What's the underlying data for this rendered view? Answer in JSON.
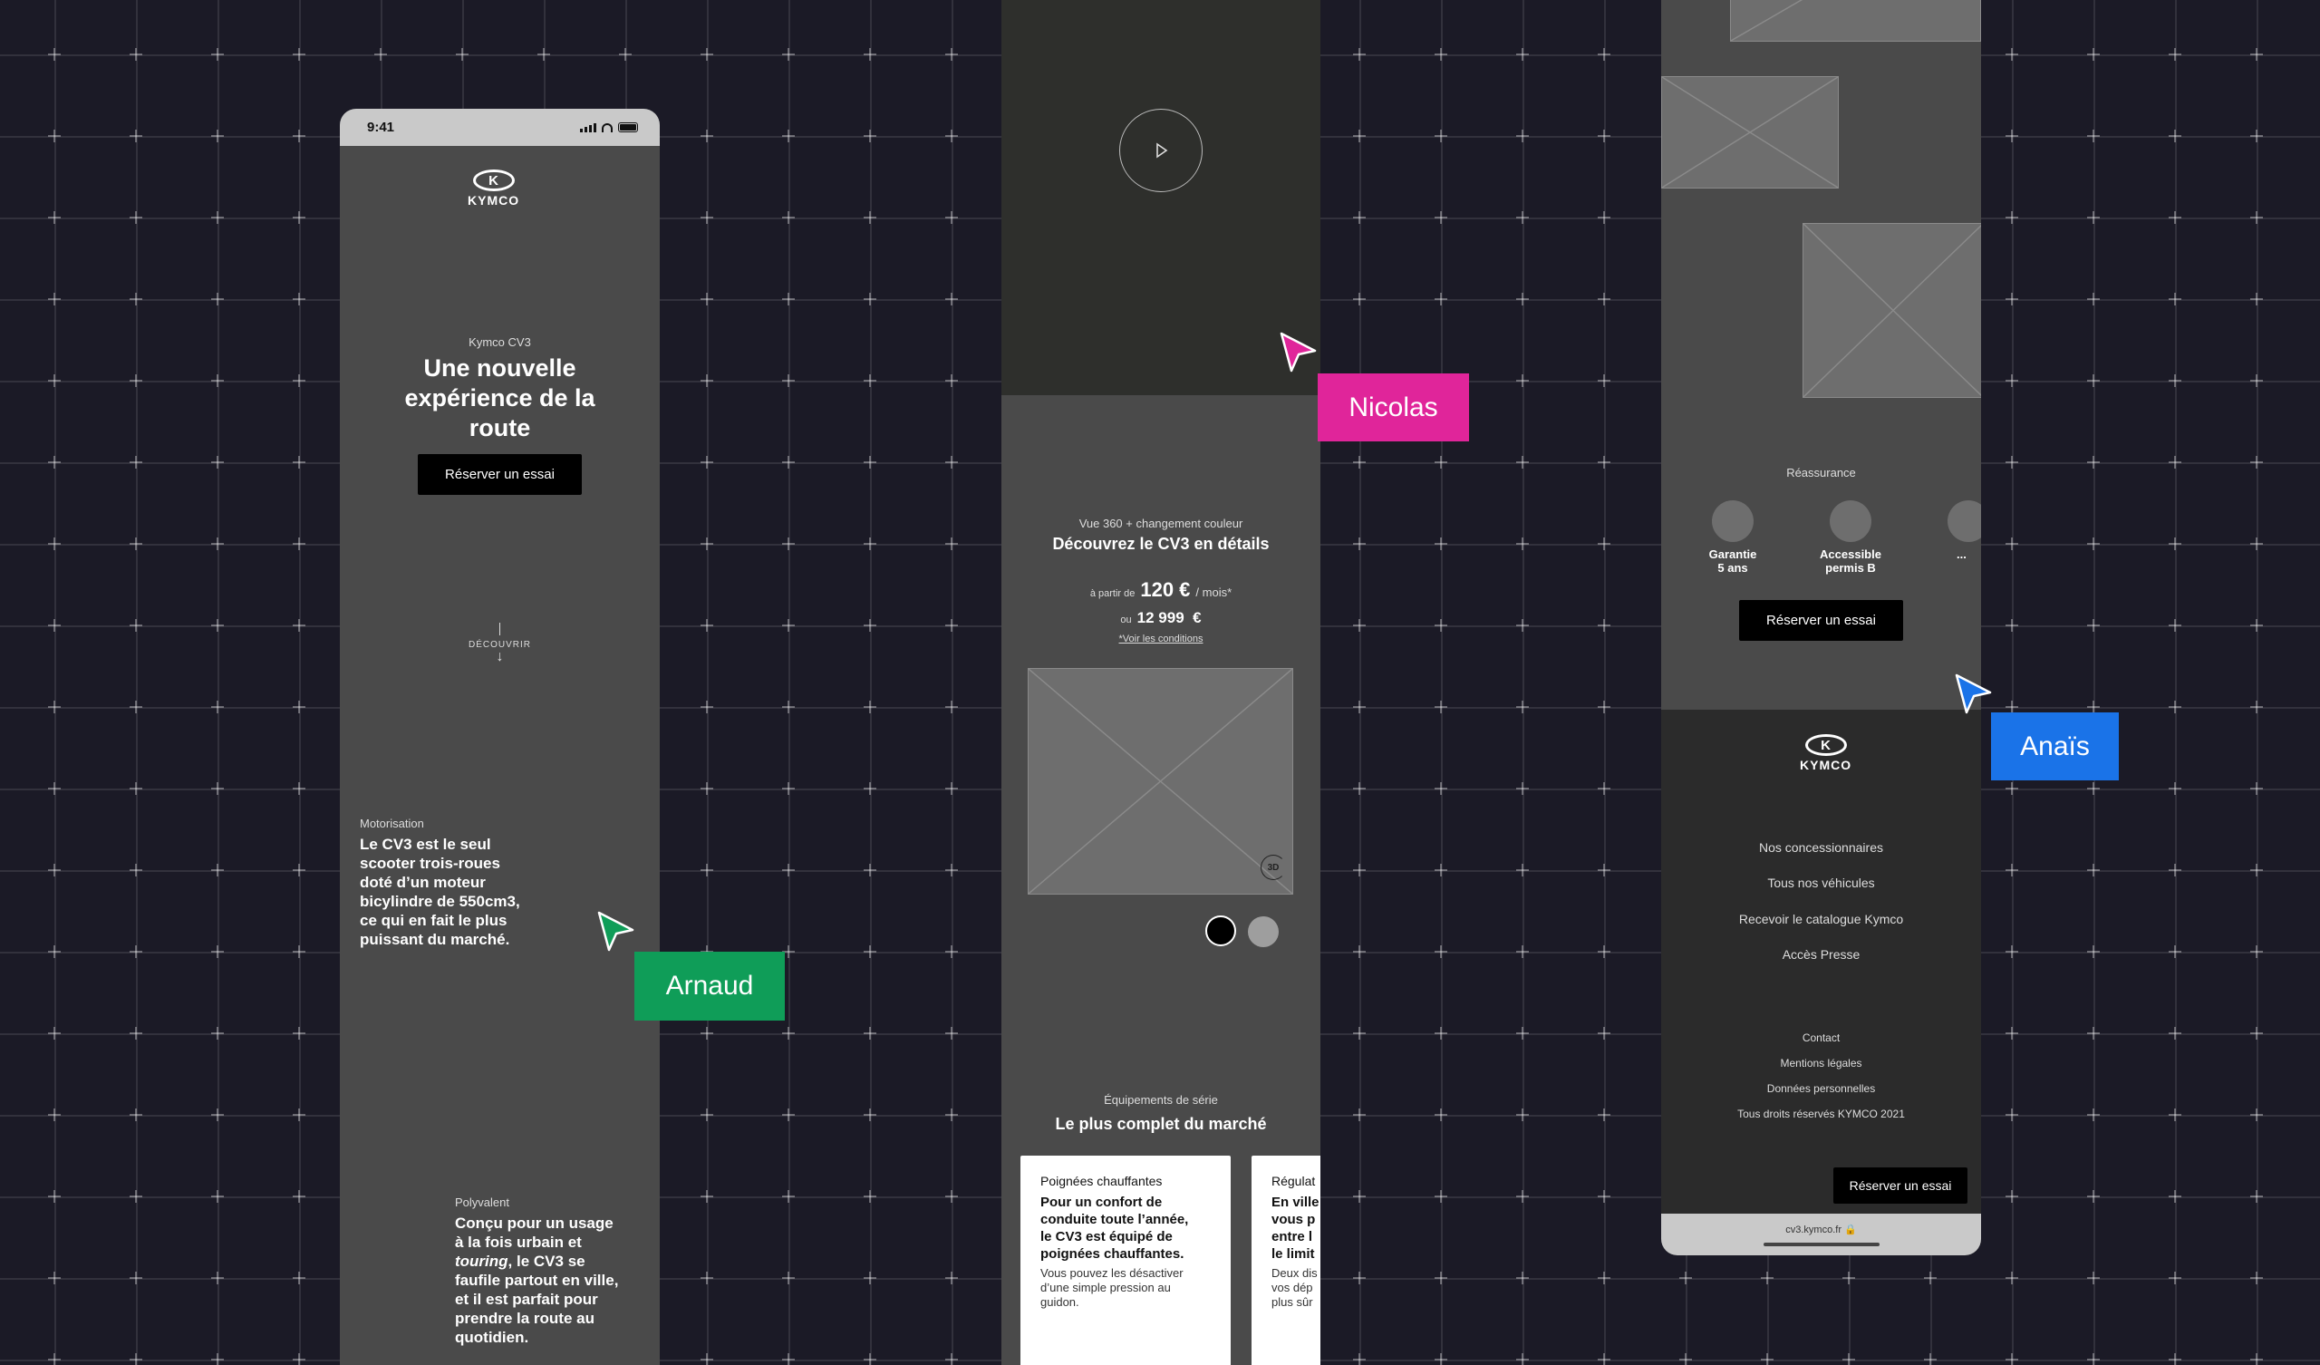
{
  "phone1": {
    "status_time": "9:41",
    "logo_text": "KYMCO",
    "hero_eyebrow": "Kymco CV3",
    "hero_title_lines": [
      "Une nouvelle",
      "expérience de la",
      "route"
    ],
    "hero_button": "Réserver un essai",
    "scroll_label": "DÉCOUVRIR",
    "section1_eyebrow": "Motorisation",
    "section1_lines": [
      "Le CV3 est le seul",
      "scooter trois-roues",
      "doté d’un moteur",
      "bicylindre de 550cm3,",
      "ce qui en fait le plus",
      "puissant du marché."
    ],
    "section2_eyebrow": "Polyvalent",
    "section2_line1": "Conçu pour un usage",
    "section2_line2": "à la fois urbain et",
    "section2_line3_em": "touring",
    "section2_line3_rest": ", le CV3 se",
    "section2_line4": "faufile partout en ville,",
    "section2_line5": "et il est parfait pour",
    "section2_line6": "prendre la route au",
    "section2_line7": "quotidien."
  },
  "phone2": {
    "details_eyebrow": "Vue 360 + changement couleur",
    "details_title": "Découvrez le CV3 en détails",
    "price_prefix": "à partir de",
    "price_main": "120 €",
    "price_suffix": "/ mois*",
    "price_alt_prefix": "ou",
    "price_alt": "12 999  €",
    "conditions_link": "*Voir les conditions",
    "badge_3d": "3D",
    "equip_eyebrow": "Équipements de série",
    "equip_title": "Le plus complet du marché",
    "card1": {
      "title": "Poignées chauffantes",
      "bold_lines": [
        "Pour un confort de",
        "conduite toute l’année,",
        "le CV3 est équipé de",
        "poignées chauffantes."
      ],
      "body_lines": [
        "Vous pouvez les désactiver",
        "d’une simple pression au",
        "guidon."
      ]
    },
    "card2": {
      "title": "Régulat",
      "bold_lines": [
        "En ville",
        "vous p",
        "entre l",
        "le limit"
      ],
      "body_lines": [
        "Deux dis",
        "vos dép",
        "plus sûr"
      ]
    }
  },
  "phone3": {
    "reassurance_title": "Réassurance",
    "reassurance_items": [
      {
        "line1": "Garantie",
        "line2": "5 ans"
      },
      {
        "line1": "Accessible",
        "line2": "permis B"
      },
      {
        "line1": "...",
        "line2": ""
      }
    ],
    "reassurance_button": "Réserver un essai",
    "logo_text": "KYMCO",
    "nav_links": [
      "Nos concessionnaires",
      "Tous nos véhicules",
      "Recevoir le catalogue Kymco",
      "Accès Presse"
    ],
    "footer_links": [
      "Contact",
      "Mentions légales",
      "Données personnelles",
      "Tous droits réservés KYMCO 2021"
    ],
    "sticky_button": "Réserver un essai",
    "url_bar": "cv3.kymco.fr"
  },
  "collaborators": [
    {
      "name": "Arnaud",
      "color": "#0f9d58"
    },
    {
      "name": "Nicolas",
      "color": "#e0259a"
    },
    {
      "name": "Anaïs",
      "color": "#1a73e8"
    }
  ],
  "colors": {
    "background": "#1b1a26",
    "screen": "#4a4a4a",
    "swatch_black": "#000000",
    "swatch_grey": "#9e9e9e"
  }
}
